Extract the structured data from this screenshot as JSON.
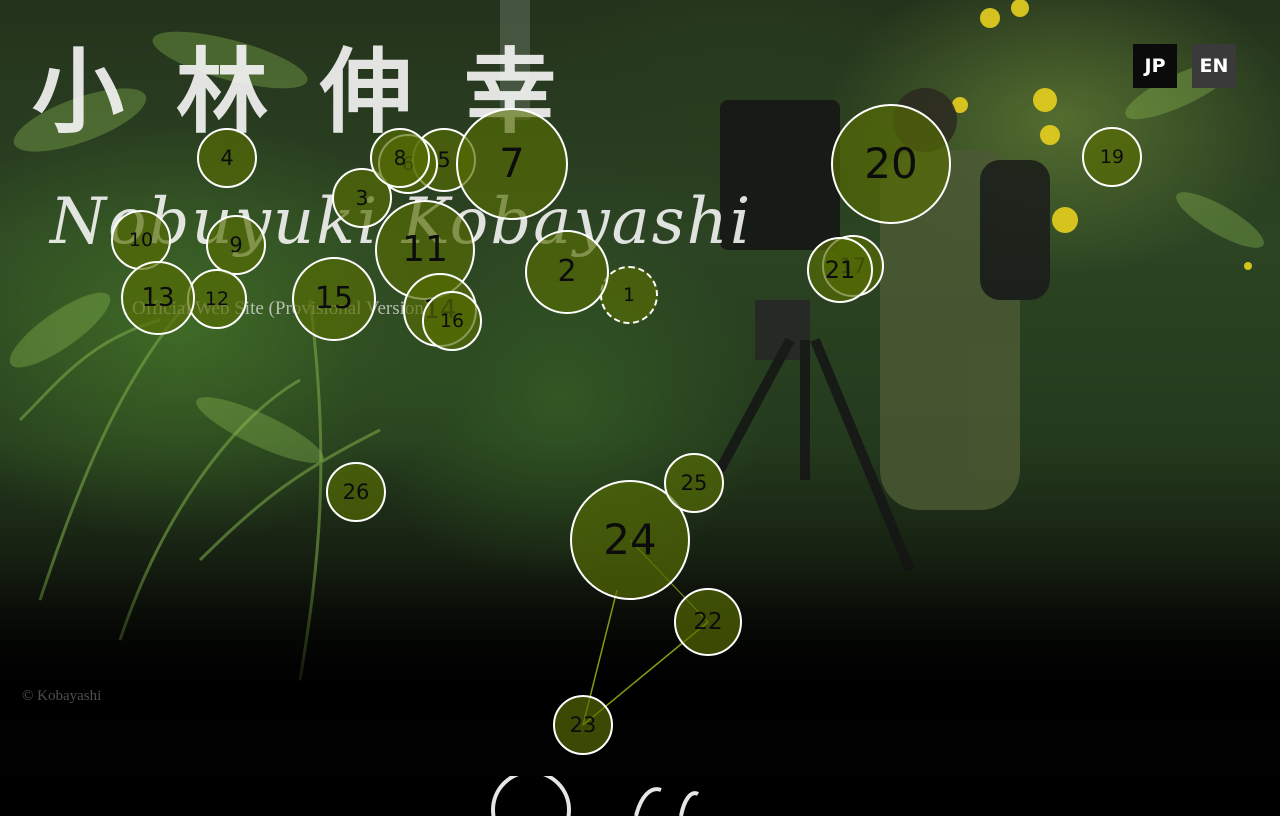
{
  "site": {
    "title_jp": "小林伸幸",
    "title_en": "Nobuyuki Kobayashi",
    "subtitle": "Official Web Site (Provisional Version)",
    "copyright": "© Kobayashi"
  },
  "language": {
    "jp": "JP",
    "en": "EN",
    "selected": "JP"
  },
  "nodes": [
    {
      "label": "1",
      "style": "dashed"
    },
    {
      "label": "2"
    },
    {
      "label": "3"
    },
    {
      "label": "4"
    },
    {
      "label": "5"
    },
    {
      "label": "6"
    },
    {
      "label": "7"
    },
    {
      "label": "8"
    },
    {
      "label": "9"
    },
    {
      "label": "10"
    },
    {
      "label": "11"
    },
    {
      "label": "12"
    },
    {
      "label": "13"
    },
    {
      "label": "14"
    },
    {
      "label": "15"
    },
    {
      "label": "16"
    },
    {
      "label": "17"
    },
    {
      "label": "19"
    },
    {
      "label": "20"
    },
    {
      "label": "21"
    },
    {
      "label": "22"
    },
    {
      "label": "23"
    },
    {
      "label": "24"
    },
    {
      "label": "25"
    },
    {
      "label": "26"
    }
  ],
  "colors": {
    "node_fill": "#566c04",
    "node_border": "#ffffff",
    "link_line": "#8a9a10"
  }
}
